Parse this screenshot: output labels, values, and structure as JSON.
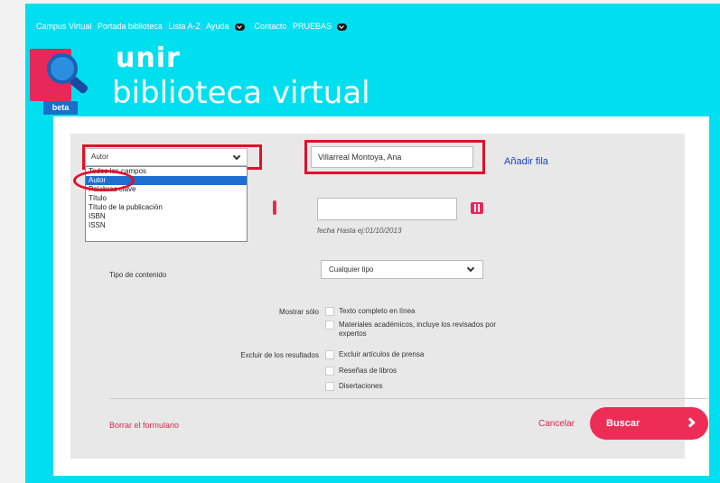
{
  "topnav": {
    "items": [
      "Campus Virtual",
      "Portada biblioteca",
      "Lista A-Z",
      "Ayuda",
      "Contacto",
      "PRUEBAS"
    ]
  },
  "logo": {
    "brand_line1": "unir",
    "brand_line2": "biblioteca virtual",
    "badge": "beta"
  },
  "search": {
    "field_select_value": "Autor",
    "field_options": [
      "Todos los campos",
      "Autor",
      "Palabras clave",
      "Título",
      "Título de la publicación",
      "ISBN",
      "ISSN"
    ],
    "selected_option_index": 1,
    "author_input_value": "Villarreal Montoya, Ana",
    "add_row_label": "Añadir fila",
    "date_hint": "fecha Hasta ej:01/10/2013"
  },
  "filters": {
    "content_type_label": "Tipo de contenido",
    "content_type_value": "Cualquier tipo",
    "show_only_label": "Mostrar sólo",
    "show_only_options": [
      "Texto completo en línea",
      "Materiales académicos, incluye los revisados por expertos"
    ],
    "exclude_label": "Excluir de los resultados",
    "exclude_options": [
      "Excluir artículos de prensa",
      "Reseñas de libros",
      "Disertaciones"
    ]
  },
  "actions": {
    "clear_form": "Borrar el formulario",
    "cancel": "Cancelar",
    "search": "Buscar"
  },
  "colors": {
    "header_bg": "#00dff0",
    "accent": "#ee2d57",
    "link_blue": "#1a3fd0",
    "highlight_red": "#e0102a"
  }
}
